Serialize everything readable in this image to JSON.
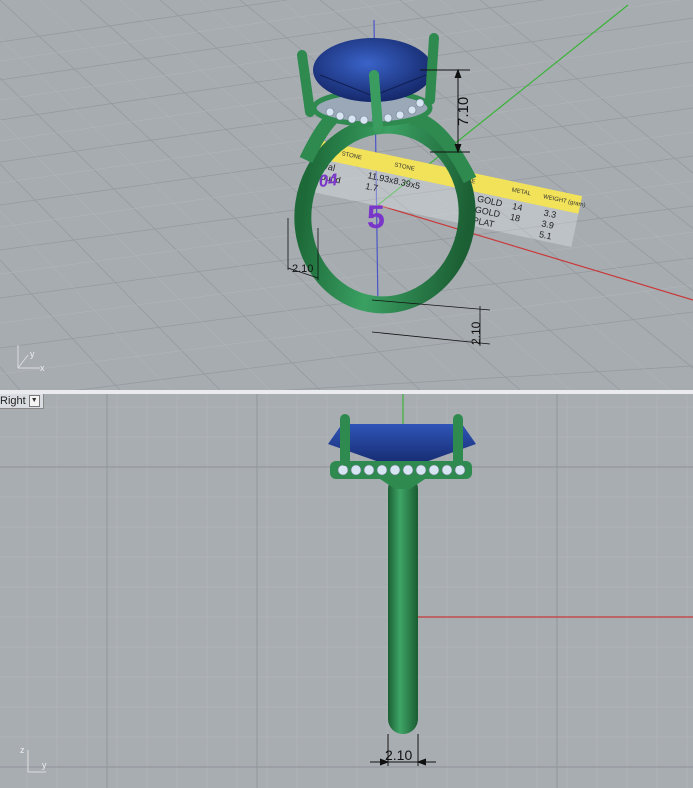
{
  "viewports": {
    "perspective": {
      "axis_y": "y",
      "axis_x": "x",
      "dimension_height": "7.10",
      "dimension_shank_left": "2.10",
      "dimension_shank_right": "2.10",
      "size_label": "5",
      "model_id": "004",
      "table": {
        "headers": [
          "STONE",
          "STONE",
          "STONE",
          "METAL",
          "WEIGHT (gram)"
        ],
        "rows": [
          [
            "Oval",
            "",
            "",
            "GOLD",
            "14",
            "3.3"
          ],
          [
            "Round",
            "",
            "",
            "GOLD",
            "18",
            "3.9"
          ],
          [
            "",
            "",
            "",
            "PLAT",
            "",
            "5.1"
          ]
        ],
        "stone_sizes": [
          "11.93x8.39x5",
          "1.7"
        ]
      }
    },
    "right": {
      "label": "Right",
      "axis_z": "z",
      "axis_y": "y",
      "dimension_width": "2.10"
    }
  },
  "colors": {
    "metal": "#2e8a4f",
    "stone": "#1f3f8c",
    "purple_text": "#7a35c9",
    "table_yellow": "#f2e25a",
    "x_axis": "#c83a3a",
    "y_axis": "#3bb33b",
    "z_axis": "#4a55c8"
  }
}
